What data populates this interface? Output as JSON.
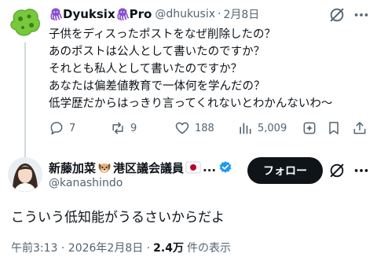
{
  "reply": {
    "name": "Dyuksix",
    "name_suffix": "Pro",
    "handle": "@dhukusix",
    "separator": "·",
    "date": "2月8日",
    "lines": [
      "子供をディスったポストをなぜ削除したの？",
      "あのポストは公人として書いたのですか？",
      "それとも私人として書いたのですか？",
      "あなたは偏差値教育で一体何を学んだの？",
      "低学歴だからはっきり言ってくれないとわかんないわ〜"
    ],
    "actions": {
      "replies": "7",
      "reposts": "9",
      "likes": "188",
      "views": "5,009"
    }
  },
  "main": {
    "name": "新藤加菜",
    "name_mid": "港区議会議員",
    "name_ellipsis": "...",
    "handle": "@kanashindo",
    "follow_label": "フォロー",
    "text": "こういう低知能がうるさいからだよ",
    "timestamp": "午前3:13 · 2026年2月8日 ·",
    "views_count": "2.4万",
    "views_label": "件の表示"
  },
  "colors": {
    "text_primary": "#0f1419",
    "text_secondary": "#536471",
    "verified_blue": "#1d9bf0",
    "octopus_purple": "#8a4fd0",
    "avatar_green": "#78c83c",
    "follow_bg": "#0f1419"
  }
}
